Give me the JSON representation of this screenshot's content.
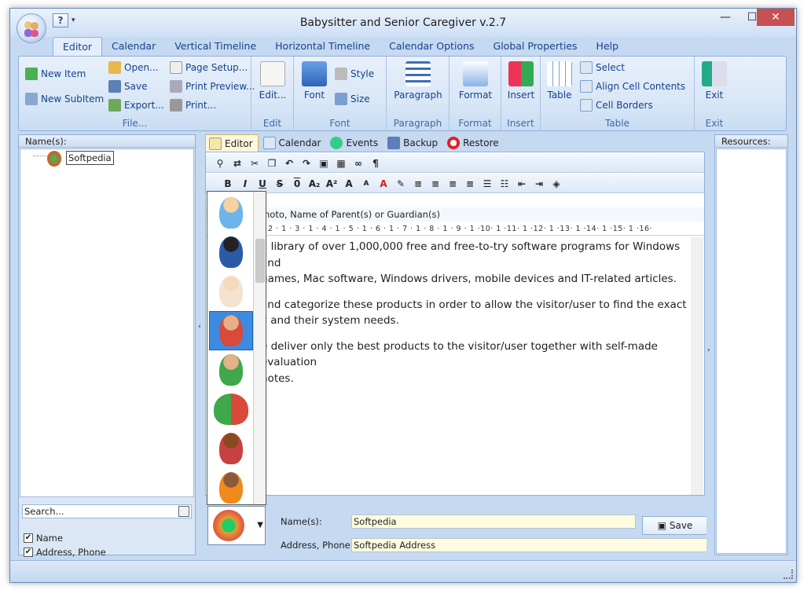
{
  "window": {
    "title": "Babysitter and Senior Caregiver v.2.7",
    "close_label": "✕",
    "minimize_label": "—",
    "maximize_label": "☐"
  },
  "qat": {
    "help_label": "?",
    "dropdown_label": "▾"
  },
  "tabs": [
    "Editor",
    "Calendar",
    "Vertical Timeline",
    "Horizontal Timeline",
    "Calendar Options",
    "Global Properties",
    "Help"
  ],
  "ribbon": {
    "file": {
      "new_item": "New Item",
      "new_subitem": "New SubItem",
      "open": "Open...",
      "save": "Save",
      "export": "Export...",
      "page_setup": "Page Setup...",
      "print_preview": "Print Preview...",
      "print": "Print...",
      "label": "File..."
    },
    "edit": {
      "edit": "Edit...",
      "label": "Edit"
    },
    "font": {
      "font": "Font",
      "style": "Style",
      "size": "Size",
      "label": "Font"
    },
    "paragraph": {
      "paragraph": "Paragraph",
      "label": "Paragraph"
    },
    "format": {
      "format": "Format",
      "label": "Format"
    },
    "insert": {
      "insert": "Insert",
      "label": "Insert"
    },
    "table": {
      "table": "Table",
      "select": "Select",
      "align": "Align Cell Contents",
      "borders": "Cell Borders",
      "label": "Table"
    },
    "exit": {
      "exit": "Exit",
      "label": "Exit"
    }
  },
  "left_panel": {
    "header": "Name(s):",
    "tree_item": "Softpedia",
    "search_placeholder": "Search...",
    "check_name": "Name",
    "check_address": "Address, Phone"
  },
  "doc_tabs": [
    "Editor",
    "Calendar",
    "Events",
    "Backup",
    "Restore"
  ],
  "field_label": "hoto, Name of Parent(s) or Guardian(s)",
  "ruler": "· 2 · 1 · 3 · 1 · 4 · 1 · 5 · 1 · 6 · 1 · 7 · 1 · 8 · 1 · 9 · 1 ·10· 1 ·11· 1 ·12· 1 ·13· 1 ·14· 1 ·15· 1 ·16·",
  "document": {
    "p1a": "a library of over 1,000,000 free and free-to-try software programs for Windows and",
    "p1b": "games, Mac software, Windows drivers, mobile devices and IT-related articles.",
    "p2a": "and categorize these products in order to allow the visitor/user to find the exact",
    "p2b": "y and their system needs.",
    "p3a": "e deliver only the best products to the visitor/user together with self-made evaluation",
    "p3b": "notes."
  },
  "form": {
    "name_label": "Name(s):",
    "name_value": "Softpedia",
    "address_label": "Address, Phone:",
    "address_value": "Softpedia Address",
    "save_label": "Save"
  },
  "right_panel": {
    "header": "Resources:"
  },
  "avatars": [
    "baby-boy-icon",
    "toddler-icon",
    "angel-baby-icon",
    "girl-red-shirt-icon",
    "boy-green-shirt-icon",
    "boy-girl-pair-icon",
    "girl-pigtails-icon",
    "dark-skinned-boy-icon"
  ],
  "colors": {
    "accent": "#3d8be0",
    "ribbon_text": "#15428b",
    "frame": "#c5d9f1"
  }
}
